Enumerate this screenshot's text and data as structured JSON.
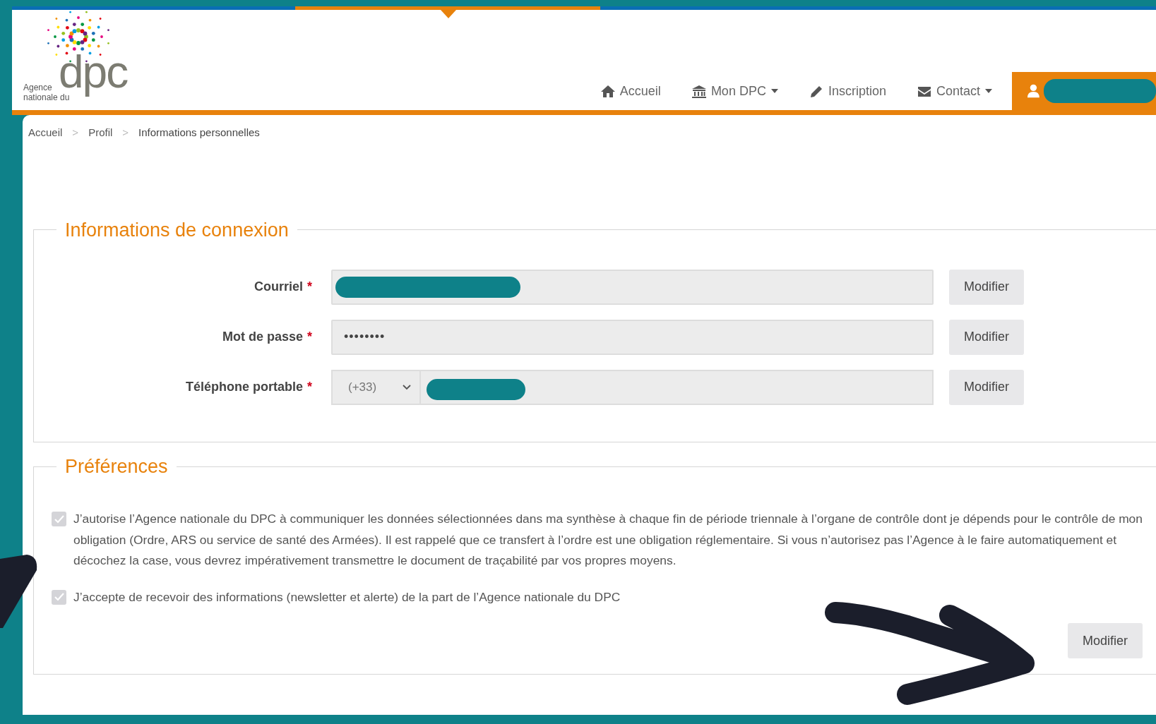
{
  "logo": {
    "line1": "Agence",
    "line2": "nationale du",
    "mark": "dpc"
  },
  "nav": [
    {
      "label": "Accueil",
      "dropdown": false
    },
    {
      "label": "Mon DPC",
      "dropdown": true
    },
    {
      "label": "Inscription",
      "dropdown": false
    },
    {
      "label": "Contact",
      "dropdown": true
    }
  ],
  "breadcrumb": [
    {
      "kind": "link",
      "text": "Accueil"
    },
    {
      "kind": "sep",
      "text": ">"
    },
    {
      "kind": "link",
      "text": "Profil"
    },
    {
      "kind": "sep",
      "text": ">"
    },
    {
      "kind": "current",
      "text": "Informations personnelles"
    }
  ],
  "connexion": {
    "legend": "Informations de connexion",
    "fields": [
      {
        "label": "Courriel",
        "required_mark": "*",
        "kind": "redacted",
        "button": "Modifier"
      },
      {
        "label": "Mot de passe",
        "required_mark": "*",
        "kind": "password",
        "value": "••••••••",
        "button": "Modifier"
      },
      {
        "label": "Téléphone portable",
        "required_mark": "*",
        "kind": "phone",
        "prefix": "(+33)",
        "button": "Modifier"
      }
    ]
  },
  "preferences": {
    "legend": "Préférences",
    "checkboxes": [
      {
        "text": "J’autorise l’Agence nationale du DPC à communiquer les données sélectionnées dans ma synthèse à chaque fin de période triennale à l’organe de contrôle dont je dépends pour le contrôle de mon obligation (Ordre, ARS ou service de santé des Armées). Il est rappelé que ce transfert à l’ordre est une obligation réglementaire. Si vous n’autorisez pas l’Agence à le faire automatiquement et décochez la case, vous devrez impérativement transmettre le document de traçabilité par vos propres moyens.",
        "checked": true,
        "disabled": true
      },
      {
        "text": "J’accepte de recevoir des informations (newsletter et alerte) de la part de l’Agence nationale du DPC",
        "checked": true,
        "disabled": true
      }
    ],
    "button": "Modifier"
  }
}
